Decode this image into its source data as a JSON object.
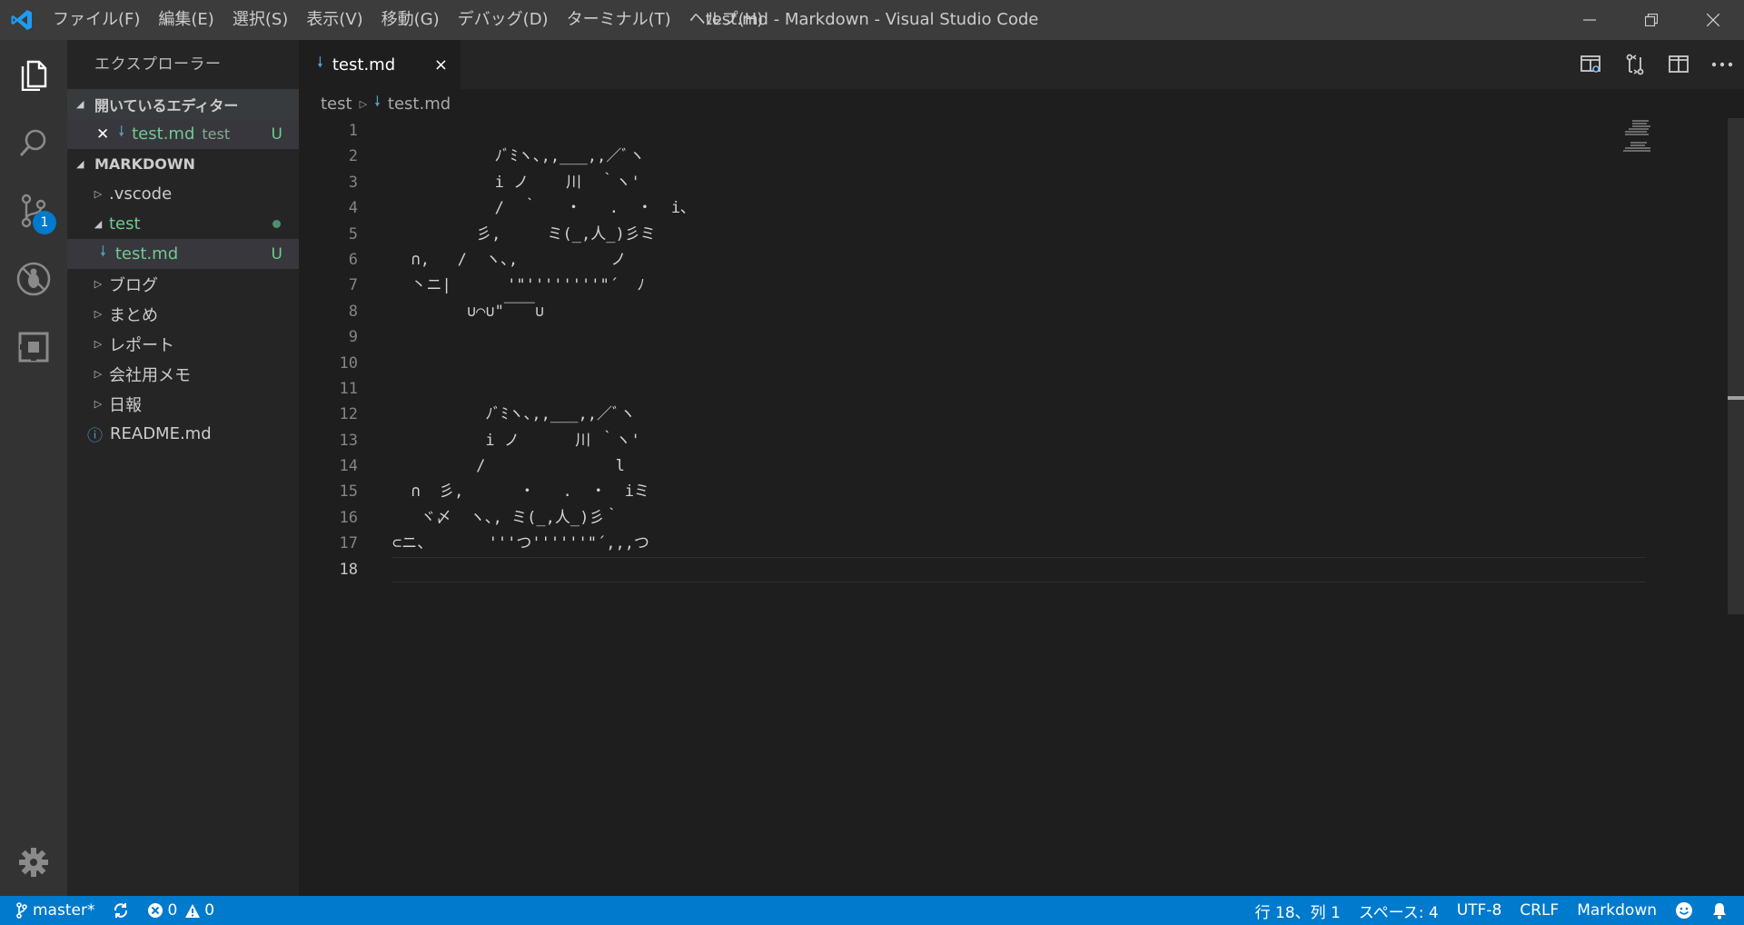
{
  "titlebar": {
    "menus": [
      "ファイル(F)",
      "編集(E)",
      "選択(S)",
      "表示(V)",
      "移動(G)",
      "デバッグ(D)",
      "ターミナル(T)",
      "ヘルプ(H)"
    ],
    "window_title": "test.md - Markdown - Visual Studio Code"
  },
  "activitybar": {
    "scm_badge": "1"
  },
  "sidebar": {
    "title": "エクスプローラー",
    "open_editors_header": "開いているエディター",
    "open_editor": {
      "name": "test.md",
      "folder": "test",
      "status": "U"
    },
    "workspace_header": "MARKDOWN",
    "tree": [
      {
        "label": ".vscode"
      },
      {
        "label": "test"
      },
      {
        "label": "test.md",
        "status": "U"
      },
      {
        "label": "ブログ"
      },
      {
        "label": "まとめ"
      },
      {
        "label": "レポート"
      },
      {
        "label": "会社用メモ"
      },
      {
        "label": "日報"
      },
      {
        "label": "README.md"
      }
    ]
  },
  "tab": {
    "label": "test.md",
    "close": "×"
  },
  "breadcrumb": {
    "folder": "test",
    "file": "test.md"
  },
  "editor": {
    "line_numbers": [
      "1",
      "2",
      "3",
      "4",
      "5",
      "6",
      "7",
      "8",
      "9",
      "10",
      "11",
      "12",
      "13",
      "14",
      "15",
      "16",
      "17",
      "18"
    ],
    "lines": [
      "",
      "           ﾉﾞﾐヽ､,,___,,／ﾞヽ",
      "           i ノ    川  ｀ヽ'",
      "           /  ｀   ・   .  ・  i､",
      "         彡,     ミ(_,人_)彡ミ",
      "  ∩,   /  ヽ､,          ノ",
      "  丶ニ|      '\"''''''''\"´  ﾉ",
      "        ∪⌒∪\"￣￣∪",
      "",
      "",
      "",
      "          ﾉﾞﾐヽ､,,___,,／ﾞヽ",
      "          i ノ      川 ｀ヽ'",
      "         /              l",
      "  ∩  彡,      ・   .  ・  iミ",
      "   ヾ〆  ヽ､, ミ(_,人_)彡｀",
      "⊂ニ、      '''つ''''''\"´,,,つ",
      ""
    ]
  },
  "statusbar": {
    "branch": "master*",
    "errors": "0",
    "warnings": "0",
    "position": "行 18、列 1",
    "indent": "スペース: 4",
    "encoding": "UTF-8",
    "eol": "CRLF",
    "language": "Markdown"
  },
  "colors": {
    "accent": "#007acc",
    "untracked": "#73c991",
    "markdown_icon": "#519aba"
  }
}
